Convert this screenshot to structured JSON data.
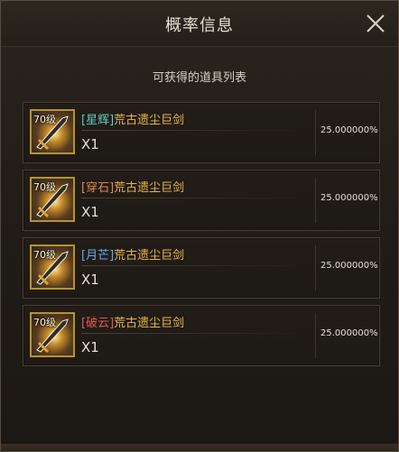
{
  "window": {
    "title": "概率信息"
  },
  "subtitle": "可获得的道具列表",
  "items": [
    {
      "level": "70级",
      "tag": "[星辉]",
      "tag_color": "#5fd0c2",
      "name": "荒古遗尘巨剑",
      "qty": "X1",
      "prob": "25.000000%"
    },
    {
      "level": "70级",
      "tag": "[穿石]",
      "tag_color": "#dc8a48",
      "name": "荒古遗尘巨剑",
      "qty": "X1",
      "prob": "25.000000%"
    },
    {
      "level": "70级",
      "tag": "[月芒]",
      "tag_color": "#68a9ee",
      "name": "荒古遗尘巨剑",
      "qty": "X1",
      "prob": "25.000000%"
    },
    {
      "level": "70级",
      "tag": "[破云]",
      "tag_color": "#e2584f",
      "name": "荒古遗尘巨剑",
      "qty": "X1",
      "prob": "25.000000%"
    }
  ],
  "colors": {
    "item_name": "#e9b64a",
    "frame": "#b8922f"
  },
  "icons": {
    "close": "close-icon",
    "item": "greatsword-icon"
  }
}
